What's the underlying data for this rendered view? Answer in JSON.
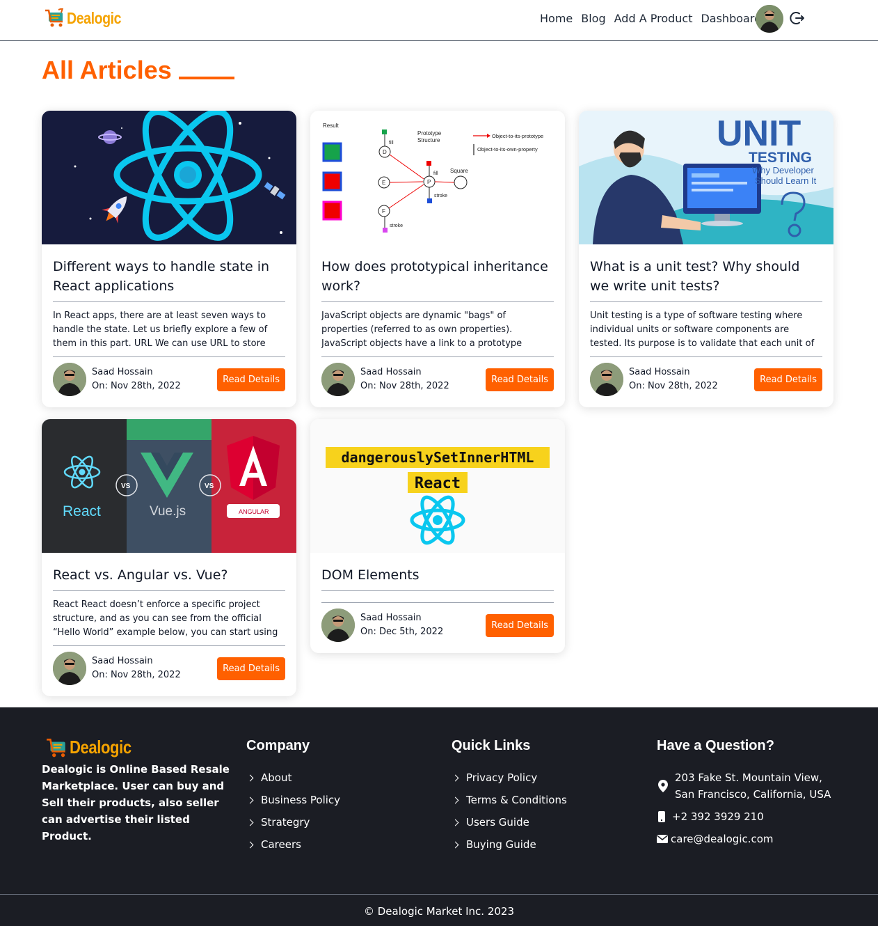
{
  "brand": {
    "name": "Dealogic",
    "color": "#ff6000",
    "logo_color": "#f5a300"
  },
  "nav": {
    "links": [
      "Home",
      "Blog",
      "Add A Product",
      "Dashboard"
    ],
    "avatar_icon": "user-avatar",
    "logout_icon": "logout-icon"
  },
  "page": {
    "title": "All Articles"
  },
  "articles": [
    {
      "image": "react-atom-space-illustration",
      "title": "Different ways to handle state in React applications",
      "excerpt": "In React apps, there are at least seven ways to handle the state. Let us briefly explore a few of them in this part. URL We can use URL to store some",
      "author": "Saad Hossain",
      "date": "On: Nov 28th, 2022",
      "button": "Read Details"
    },
    {
      "image": "prototype-diagram",
      "image_text": {
        "result": "Result",
        "proto": "Prototype",
        "structure": "Structure",
        "legend1": "Object-to-its-prototype",
        "legend2": "Object-to-its-own-property",
        "fill": "fill",
        "stroke": "stroke",
        "square": "Square",
        "nodes": [
          "D",
          "E",
          "F",
          "P"
        ]
      },
      "title": "How does prototypical inheritance work?",
      "excerpt": "JavaScript objects are dynamic \"bags\" of properties (referred to as own properties). JavaScript objects have a link to a prototype object. When trying",
      "author": "Saad Hossain",
      "date": "On: Nov 28th, 2022",
      "button": "Read Details"
    },
    {
      "image": "unit-testing-banner",
      "image_text": {
        "line1": "UNIT",
        "line2": "TESTING",
        "line3": "Why Developer",
        "line4": "Should Learn It"
      },
      "title": "What is a unit test? Why should we write unit tests?",
      "excerpt": "Unit testing is a type of software testing where individual units or software components are tested. Its purpose is to validate that each unit of code",
      "author": "Saad Hossain",
      "date": "On: Nov 28th, 2022",
      "button": "Read Details"
    },
    {
      "image": "react-vue-angular-comparison",
      "image_text": {
        "react": "React",
        "vue": "Vue.js",
        "angular": "ANGULAR",
        "vs": "VS"
      },
      "title": "React vs. Angular vs. Vue?",
      "excerpt": "React React doesn’t enforce a specific project structure, and as you can see from the official “Hello World” example below, you can start using React",
      "author": "Saad Hossain",
      "date": "On: Nov 28th, 2022",
      "button": "Read Details"
    },
    {
      "image": "dangerously-set-inner-html-banner",
      "image_text": {
        "line1": "dangerouslySetInnerHTML",
        "line2": "React"
      },
      "title": "DOM Elements",
      "excerpt": "",
      "author": "Saad Hossain",
      "date": "On: Dec 5th, 2022",
      "button": "Read Details"
    }
  ],
  "footer": {
    "about": "Dealogic is Online Based Resale Marketplace. User can buy and Sell their products, also seller can advertise their listed Product.",
    "company": {
      "heading": "Company",
      "links": [
        "About",
        "Business Policy",
        "Strategry",
        "Careers"
      ]
    },
    "quick": {
      "heading": "Quick Links",
      "links": [
        "Privacy Policy",
        "Terms & Conditions",
        "Users Guide",
        "Buying Guide"
      ]
    },
    "contact": {
      "heading": "Have a Question?",
      "address": "203 Fake St. Mountain View, San Francisco, California, USA",
      "phone": "+2 392 3929 210",
      "email": "care@dealogic.com"
    },
    "copyright": "© Dealogic Market Inc. 2023"
  }
}
